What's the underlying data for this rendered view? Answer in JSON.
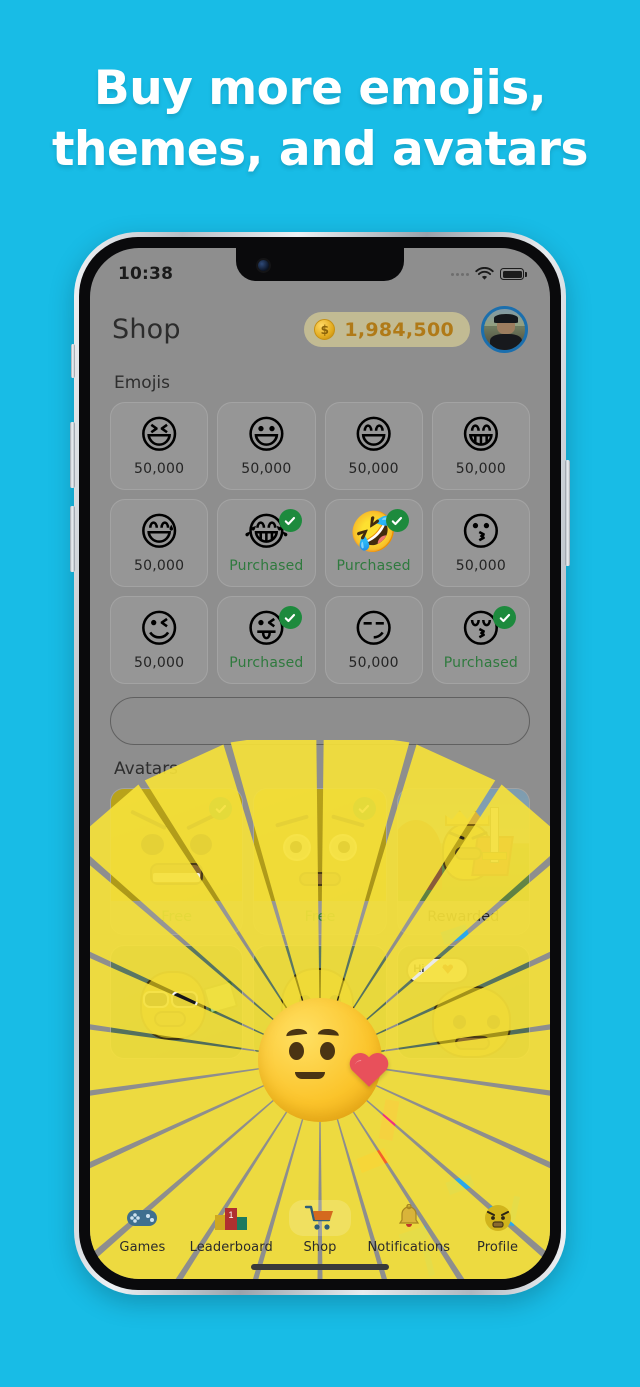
{
  "promo": {
    "headline_line1": "Buy more emojis,",
    "headline_line2": "themes, and avatars",
    "background_color": "#18BCE6",
    "text_color": "#FFFFFF"
  },
  "status_bar": {
    "time": "10:38",
    "wifi_icon": "wifi-icon",
    "battery_icon": "battery-icon",
    "signal_icon": "signal-dots-icon"
  },
  "header": {
    "title": "Shop",
    "coin_icon": "coin-icon",
    "coin_symbol": "$",
    "coin_amount": "1,984,500",
    "coin_pill_color": "#E2D696",
    "coin_text_color": "#B07A18",
    "avatar": "profile-avatar-photo",
    "avatar_ring_color": "#1B6FAE"
  },
  "sections": {
    "emojis_label": "Emojis",
    "avatars_label": "Avatars"
  },
  "emojis": [
    {
      "glyph": "😆",
      "name": "emoji-squinting-laugh",
      "status": "50,000",
      "purchased": false
    },
    {
      "glyph": "😃",
      "name": "emoji-smiley-open",
      "status": "50,000",
      "purchased": false
    },
    {
      "glyph": "😄",
      "name": "emoji-grin-smiling-eyes",
      "status": "50,000",
      "purchased": false
    },
    {
      "glyph": "😁",
      "name": "emoji-beaming",
      "status": "50,000",
      "purchased": false
    },
    {
      "glyph": "😅",
      "name": "emoji-sweat-smile",
      "status": "50,000",
      "purchased": false
    },
    {
      "glyph": "😂",
      "name": "emoji-tears-of-joy",
      "status": "Purchased",
      "purchased": true
    },
    {
      "glyph": "🤣",
      "name": "emoji-rolling-on-floor",
      "status": "Purchased",
      "purchased": true
    },
    {
      "glyph": "😗",
      "name": "emoji-kissing",
      "status": "50,000",
      "purchased": false
    },
    {
      "glyph": "😉",
      "name": "emoji-winking",
      "status": "50,000",
      "purchased": false
    },
    {
      "glyph": "😜",
      "name": "emoji-tongue-wink",
      "status": "Purchased",
      "purchased": true
    },
    {
      "glyph": "😏",
      "name": "emoji-smirking",
      "status": "50,000",
      "purchased": false
    },
    {
      "glyph": "😚",
      "name": "emoji-kissing-closed-eyes",
      "status": "Purchased",
      "purchased": true
    }
  ],
  "banner": {
    "name": "promo-banner-placeholder",
    "content": ""
  },
  "avatars": [
    {
      "name": "avatar-angry-duck",
      "status": "Free",
      "purchased": true,
      "style": "yellow-angry"
    },
    {
      "name": "avatar-worried-duck",
      "status": "Free",
      "purchased": true,
      "style": "yellow-worried"
    },
    {
      "name": "avatar-king-knight-duck",
      "status": "Rewarded",
      "purchased": false,
      "style": "king-scene"
    },
    {
      "name": "avatar-cool-money-duck",
      "status": "",
      "purchased": false,
      "style": "green-sunglasses"
    },
    {
      "name": "avatar-happy-duck",
      "status": "",
      "purchased": false,
      "style": "green-happy"
    },
    {
      "name": "avatar-hi-duck",
      "status": "",
      "purchased": false,
      "style": "green-hi"
    }
  ],
  "hero": {
    "name": "hero-emoji-heart-face",
    "glyph": "🥰",
    "sunburst": "radiating-yellow-rays",
    "ray_color": "#F5E13A"
  },
  "tabs": [
    {
      "label": "Games",
      "icon": "gamepad-icon",
      "active": false
    },
    {
      "label": "Leaderboard",
      "icon": "podium-icon",
      "active": false,
      "badge": "1"
    },
    {
      "label": "Shop",
      "icon": "shopping-cart-icon",
      "active": true
    },
    {
      "label": "Notifications",
      "icon": "bell-icon",
      "active": false
    },
    {
      "label": "Profile",
      "icon": "angry-face-icon",
      "active": false
    }
  ],
  "confetti_color_blue": "#2AA8EC",
  "confetti_color_pink": "#F0307F",
  "confetti_color_orange": "#F4602A",
  "checkmark_color": "#1D8A3D",
  "purchased_text_color": "#2F7A3E"
}
